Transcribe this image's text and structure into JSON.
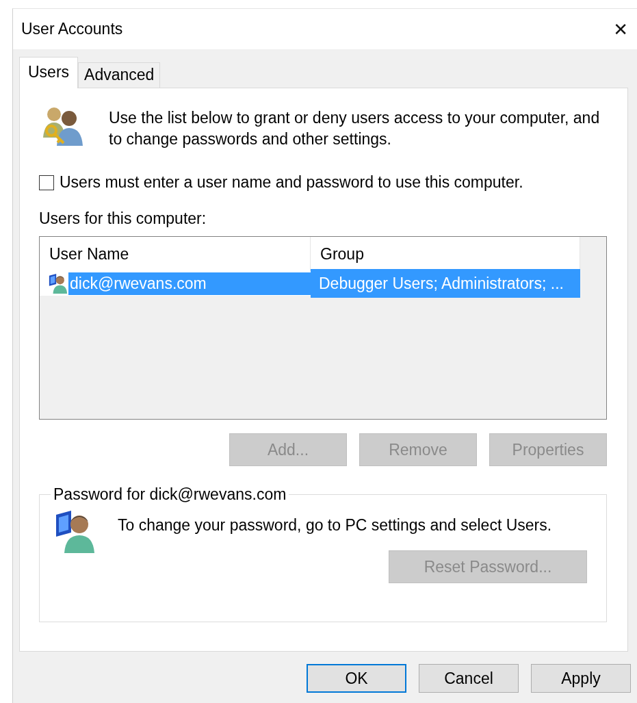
{
  "window": {
    "title": "User Accounts",
    "close": "✕"
  },
  "tabs": [
    {
      "label": "Users",
      "selected": true
    },
    {
      "label": "Advanced",
      "selected": false
    }
  ],
  "intro": "Use the list below to grant or deny users access to your computer, and to change passwords and other settings.",
  "require_login": {
    "label": "Users must enter a user name and password to use this computer.",
    "checked": false
  },
  "list_label": "Users for this computer:",
  "table": {
    "columns": [
      "User Name",
      "Group"
    ],
    "rows": [
      {
        "user_name": "dick@rwevans.com",
        "group": "Debugger Users; Administrators; ...",
        "selected": true
      }
    ]
  },
  "list_buttons": [
    {
      "label": "Add...",
      "disabled": true
    },
    {
      "label": "Remove",
      "disabled": true
    },
    {
      "label": "Properties",
      "disabled": true
    }
  ],
  "password_group": {
    "title": "Password for dick@rwevans.com",
    "text": "To change your password, go to PC settings and select Users.",
    "button": {
      "label": "Reset Password...",
      "disabled": true
    }
  },
  "dialog_buttons": [
    {
      "label": "OK",
      "default": true
    },
    {
      "label": "Cancel",
      "default": false
    },
    {
      "label": "Apply",
      "default": false
    }
  ]
}
